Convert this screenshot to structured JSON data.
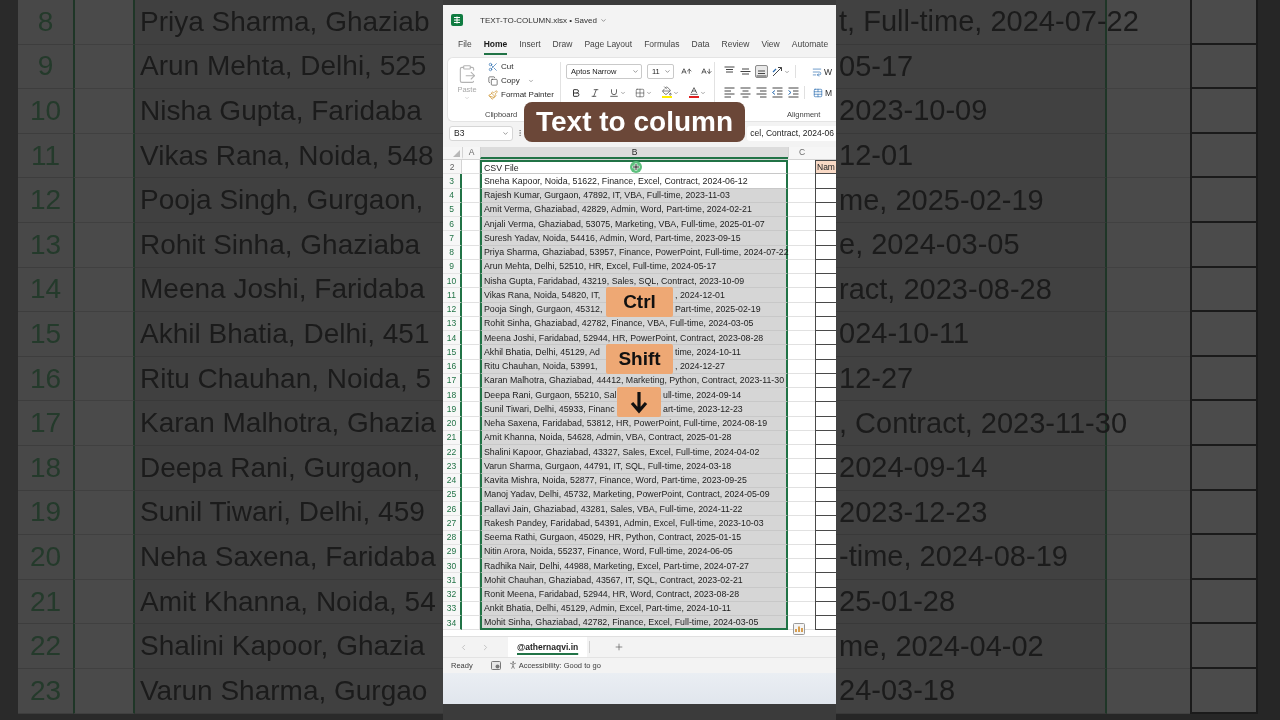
{
  "backdrop": {
    "left_rows": [
      {
        "number": "8",
        "text": "Priya Sharma, Ghaziab"
      },
      {
        "number": "9",
        "text": "Arun Mehta, Delhi, 525"
      },
      {
        "number": "10",
        "text": "Nisha Gupta, Faridaba"
      },
      {
        "number": "11",
        "text": "Vikas Rana, Noida, 548"
      },
      {
        "number": "12",
        "text": "Pooja Singh, Gurgaon,"
      },
      {
        "number": "13",
        "text": "Rohit Sinha, Ghaziaba"
      },
      {
        "number": "14",
        "text": "Meena Joshi, Faridaba"
      },
      {
        "number": "15",
        "text": "Akhil Bhatia, Delhi, 451"
      },
      {
        "number": "16",
        "text": "Ritu Chauhan, Noida, 5"
      },
      {
        "number": "17",
        "text": "Karan Malhotra, Ghazia"
      },
      {
        "number": "18",
        "text": "Deepa Rani, Gurgaon,"
      },
      {
        "number": "19",
        "text": "Sunil Tiwari, Delhi, 459"
      },
      {
        "number": "20",
        "text": "Neha Saxena, Faridaba"
      },
      {
        "number": "21",
        "text": "Amit Khanna, Noida, 54"
      },
      {
        "number": "22",
        "text": "Shalini Kapoor, Ghazia"
      },
      {
        "number": "23",
        "text": "Varun Sharma, Gurgao"
      }
    ],
    "right_texts": [
      "t, Full-time, 2024-07-22",
      "05-17",
      "2023-10-09",
      "12-01",
      "me, 2025-02-19",
      "e, 2024-03-05",
      "ract, 2023-08-28",
      "024-10-11",
      "12-27",
      ", Contract, 2023-11-30",
      "2024-09-14",
      "2023-12-23",
      "-time, 2024-08-19",
      "25-01-28",
      "me, 2024-04-02",
      "24-03-18"
    ]
  },
  "window": {
    "title": "TEXT-TO-COLUMN.xlsx • Saved"
  },
  "menu_tabs": [
    {
      "label": "File",
      "selected": false
    },
    {
      "label": "Home",
      "selected": true
    },
    {
      "label": "Insert",
      "selected": false
    },
    {
      "label": "Draw",
      "selected": false
    },
    {
      "label": "Page Layout",
      "selected": false
    },
    {
      "label": "Formulas",
      "selected": false
    },
    {
      "label": "Data",
      "selected": false
    },
    {
      "label": "Review",
      "selected": false
    },
    {
      "label": "View",
      "selected": false
    },
    {
      "label": "Automate",
      "selected": false
    }
  ],
  "ribbon": {
    "paste": {
      "label": "Paste",
      "disabled": true
    },
    "cut": "Cut",
    "copy": "Copy",
    "format_painter": "Format Painter",
    "clipboard_label": "Clipboard",
    "font_name": "Aptos Narrow",
    "font_size": "11",
    "vertical_align": [
      {
        "kind": "top",
        "selected": false
      },
      {
        "kind": "middle",
        "selected": false
      },
      {
        "kind": "bottom",
        "selected": true
      }
    ],
    "wrap_label": "W",
    "merge_label": "M",
    "alignment_label": "Alignment"
  },
  "formula_bar": {
    "name_box": "B3",
    "formula": "cel, Contract, 2024-06"
  },
  "sheet": {
    "columns": [
      {
        "label": "A",
        "selected": false
      },
      {
        "label": "B",
        "selected": true
      },
      {
        "label": "C",
        "selected": false
      }
    ],
    "rows": [
      {
        "number": "2",
        "selected": false,
        "highlighted": false,
        "b": [
          "CSV File"
        ],
        "d": "Nam"
      },
      {
        "number": "3",
        "selected": true,
        "highlighted": false,
        "b": [
          "Sneha Kapoor, Noida, 51622, Finance, Excel, Contract, 2024-06-12"
        ]
      },
      {
        "number": "4",
        "selected": true,
        "highlighted": true,
        "b": [
          "Rajesh Kumar, Gurgaon, 47892, IT, VBA, Full-time, 2023-11-03"
        ]
      },
      {
        "number": "5",
        "selected": true,
        "highlighted": true,
        "b": [
          "Amit Verma, Ghaziabad, 42829, Admin, Word, Part-time, 2024-02-21"
        ]
      },
      {
        "number": "6",
        "selected": true,
        "highlighted": true,
        "b": [
          "Anjali Verma, Ghaziabad, 53075, Marketing, VBA, Full-time, 2025-01-07"
        ]
      },
      {
        "number": "7",
        "selected": true,
        "highlighted": true,
        "b": [
          "Suresh Yadav, Noida, 54416, Admin, Word, Part-time, 2023-09-15"
        ]
      },
      {
        "number": "8",
        "selected": true,
        "highlighted": true,
        "b": [
          "Priya Sharma, Ghaziabad, 53957, Finance, PowerPoint, Full-time, 2024-07-22"
        ]
      },
      {
        "number": "9",
        "selected": true,
        "highlighted": true,
        "b": [
          "Arun Mehta, Delhi, 52510, HR, Excel, Full-time, 2024-05-17"
        ]
      },
      {
        "number": "10",
        "selected": true,
        "highlighted": true,
        "b": [
          "Nisha Gupta, Faridabad, 43219, Sales, SQL, Contract, 2023-10-09"
        ]
      },
      {
        "number": "11",
        "selected": true,
        "highlighted": true,
        "b": [
          "Vikas Rana, Noida, 54820, IT,",
          ", 2024-12-01"
        ]
      },
      {
        "number": "12",
        "selected": true,
        "highlighted": true,
        "b": [
          "Pooja Singh, Gurgaon, 45312,",
          "Part-time, 2025-02-19"
        ]
      },
      {
        "number": "13",
        "selected": true,
        "highlighted": true,
        "b": [
          "Rohit Sinha, Ghaziabad, 42782, Finance, VBA, Full-time, 2024-03-05"
        ]
      },
      {
        "number": "14",
        "selected": true,
        "highlighted": true,
        "b": [
          "Meena Joshi, Faridabad, 52944, HR, PowerPoint, Contract, 2023-08-28"
        ]
      },
      {
        "number": "15",
        "selected": true,
        "highlighted": true,
        "b": [
          "Akhil Bhatia, Delhi, 45129, Ad",
          "time, 2024-10-11"
        ]
      },
      {
        "number": "16",
        "selected": true,
        "highlighted": true,
        "b": [
          "Ritu Chauhan, Noida, 53991,",
          ", 2024-12-27"
        ]
      },
      {
        "number": "17",
        "selected": true,
        "highlighted": true,
        "b": [
          "Karan Malhotra, Ghaziabad, 44412, Marketing, Python, Contract, 2023-11-30"
        ]
      },
      {
        "number": "18",
        "selected": true,
        "highlighted": true,
        "b": [
          "Deepa Rani, Gurgaon, 55210, Sal",
          "ull-time, 2024-09-14"
        ]
      },
      {
        "number": "19",
        "selected": true,
        "highlighted": true,
        "b": [
          "Sunil Tiwari, Delhi, 45933, Financ",
          "art-time, 2023-12-23"
        ]
      },
      {
        "number": "20",
        "selected": true,
        "highlighted": true,
        "b": [
          "Neha Saxena, Faridabad, 53812, HR, PowerPoint, Full-time, 2024-08-19"
        ]
      },
      {
        "number": "21",
        "selected": true,
        "highlighted": true,
        "b": [
          "Amit Khanna, Noida, 54628, Admin, VBA, Contract, 2025-01-28"
        ]
      },
      {
        "number": "22",
        "selected": true,
        "highlighted": true,
        "b": [
          "Shalini Kapoor, Ghaziabad, 43327, Sales, Excel, Full-time, 2024-04-02"
        ]
      },
      {
        "number": "23",
        "selected": true,
        "highlighted": true,
        "b": [
          "Varun Sharma, Gurgaon, 44791, IT, SQL, Full-time, 2024-03-18"
        ]
      },
      {
        "number": "24",
        "selected": true,
        "highlighted": true,
        "b": [
          "Kavita Mishra, Noida, 52877, Finance, Word, Part-time, 2023-09-25"
        ]
      },
      {
        "number": "25",
        "selected": true,
        "highlighted": true,
        "b": [
          "Manoj Yadav, Delhi, 45732, Marketing, PowerPoint, Contract, 2024-05-09"
        ]
      },
      {
        "number": "26",
        "selected": true,
        "highlighted": true,
        "b": [
          "Pallavi Jain, Ghaziabad, 43281, Sales, VBA, Full-time, 2024-11-22"
        ]
      },
      {
        "number": "27",
        "selected": true,
        "highlighted": true,
        "b": [
          "Rakesh Pandey, Faridabad, 54391, Admin, Excel, Full-time, 2023-10-03"
        ]
      },
      {
        "number": "28",
        "selected": true,
        "highlighted": true,
        "b": [
          "Seema Rathi, Gurgaon, 45029, HR, Python, Contract, 2025-01-15"
        ]
      },
      {
        "number": "29",
        "selected": true,
        "highlighted": true,
        "b": [
          "Nitin Arora, Noida, 55237, Finance, Word, Full-time, 2024-06-05"
        ]
      },
      {
        "number": "30",
        "selected": true,
        "highlighted": true,
        "b": [
          "Radhika Nair, Delhi, 44988, Marketing, Excel, Part-time, 2024-07-27"
        ]
      },
      {
        "number": "31",
        "selected": true,
        "highlighted": true,
        "b": [
          "Mohit Chauhan, Ghaziabad, 43567, IT, SQL, Contract, 2023-02-21"
        ]
      },
      {
        "number": "32",
        "selected": true,
        "highlighted": true,
        "b": [
          "Ronit Meena, Faridabad, 52944, HR, Word, Contract, 2023-08-28"
        ]
      },
      {
        "number": "33",
        "selected": true,
        "highlighted": true,
        "b": [
          "Ankit Bhatia, Delhi, 45129, Admin, Excel, Part-time, 2024-10-11"
        ]
      },
      {
        "number": "34",
        "selected": true,
        "highlighted": true,
        "b": [
          "Mohit Sinha, Ghaziabad, 42782, Finance, Excel, Full-time, 2024-03-05"
        ]
      }
    ]
  },
  "sheet_tabs": [
    {
      "label": "@athernaqvi.in",
      "selected": true
    }
  ],
  "status_bar": {
    "mode": "Ready",
    "accessibility": "Accessibility: Good to go"
  },
  "overlay": {
    "caption": "Text to column",
    "keys": [
      {
        "kind": "text",
        "label": "Ctrl"
      },
      {
        "kind": "text",
        "label": "Shift"
      },
      {
        "kind": "arrow"
      }
    ]
  }
}
